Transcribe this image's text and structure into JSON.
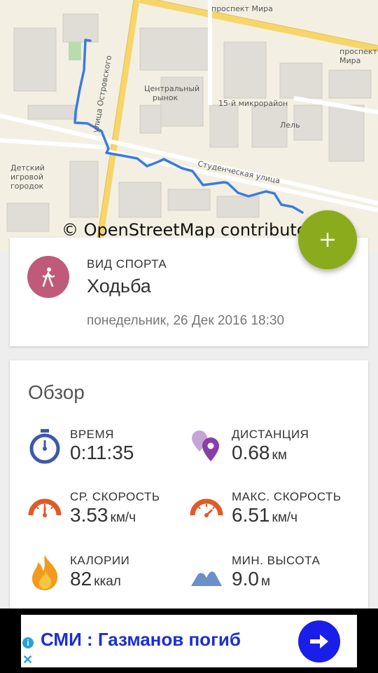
{
  "map": {
    "labels": {
      "prospekt_mira_1": "проспект Мира",
      "prospekt_mira_2": "проспект Мира",
      "ulitsa_ostrovskogo": "улица Островского",
      "central_market": "Центральный рынок",
      "microdistrict": "15-й микрорайон",
      "lel": "Лель",
      "studencheskaya": "Студенческая улица",
      "playground": "Детский игровой городок"
    },
    "attribution": "© OpenStreetMap contributors",
    "route_color": "#3b7be0"
  },
  "fab": {
    "icon": "plus-icon",
    "color": "#8aab1b"
  },
  "activity": {
    "caption": "ВИД СПОРТА",
    "name": "Ходьба",
    "date": "понедельник, 26 Дек  2016 18:30",
    "icon": "walking-person-icon",
    "color": "#c05a7b"
  },
  "overview": {
    "title": "Обзор",
    "stats": {
      "time": {
        "label": "ВРЕМЯ",
        "value": "0:11:35",
        "unit": "",
        "icon": "stopwatch-icon"
      },
      "distance": {
        "label": "ДИСТАНЦИЯ",
        "value": "0.68",
        "unit": "км",
        "icon": "location-pins-icon"
      },
      "avg_speed": {
        "label": "СР. СКОРОСТЬ",
        "value": "3.53",
        "unit": "км/ч",
        "icon": "speedometer-icon"
      },
      "max_speed": {
        "label": "МАКС. СКОРОСТЬ",
        "value": "6.51",
        "unit": "км/ч",
        "icon": "speedometer-high-icon"
      },
      "calories": {
        "label": "КАЛОРИИ",
        "value": "82",
        "unit": "ккал",
        "icon": "flame-icon"
      },
      "min_altitude": {
        "label": "МИН. ВЫСОТА",
        "value": "9.0",
        "unit": "м",
        "icon": "mountains-icon"
      }
    }
  },
  "ad": {
    "text": "СМИ : Газманов погиб",
    "info_icon": "i",
    "close_icon": "✕"
  }
}
